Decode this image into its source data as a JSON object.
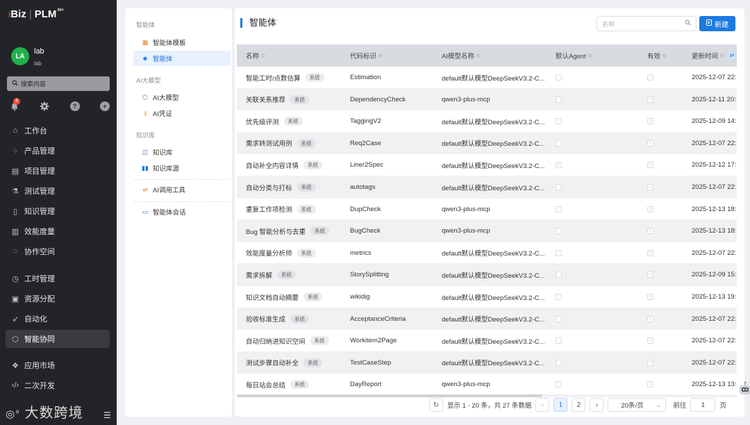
{
  "brand": {
    "name": "Biz",
    "product": "PLM",
    "sup": "AI+",
    "prefix": "i"
  },
  "user": {
    "initials": "LA",
    "name": "lab",
    "sub": "lab"
  },
  "search": {
    "placeholder": "搜索内容"
  },
  "notifications": {
    "count": "4"
  },
  "nav": [
    {
      "label": "工作台",
      "icon": "home-icon"
    },
    {
      "label": "产品管理",
      "icon": "product-icon"
    },
    {
      "label": "项目管理",
      "icon": "project-icon"
    },
    {
      "label": "测试管理",
      "icon": "flask-icon"
    },
    {
      "label": "知识管理",
      "icon": "book-icon"
    },
    {
      "label": "效能度量",
      "icon": "chart-icon"
    },
    {
      "label": "协作空间",
      "icon": "chat-icon"
    },
    {
      "label": "工时管理",
      "icon": "clock-icon"
    },
    {
      "label": "资源分配",
      "icon": "resource-icon"
    },
    {
      "label": "自动化",
      "icon": "rocket-icon"
    },
    {
      "label": "智能协同",
      "icon": "ai-icon"
    },
    {
      "label": "应用市场",
      "icon": "market-icon"
    },
    {
      "label": "二次开发",
      "icon": "code-icon"
    }
  ],
  "watermark": "大数跨境",
  "submenu": {
    "sections": {
      "agent": "智能体",
      "model": "AI大模型",
      "kb": "知识库"
    },
    "items": {
      "agent_template": "智能体模板",
      "agent": "智能体",
      "ai_model": "AI大模型",
      "ai_cred": "AI凭证",
      "kb": "知识库",
      "kb_source": "知识库源",
      "ai_tool": "AI调用工具",
      "agent_chat": "智能体会话"
    }
  },
  "page": {
    "title": "智能体",
    "name_placeholder": "名称",
    "new_button": "新建"
  },
  "table": {
    "columns": [
      "名称",
      "代码标识",
      "AI模型名称",
      "默认Agent",
      "有效",
      "更新时间"
    ],
    "system_tag": "系统",
    "rows": [
      {
        "name": "智能工时/点数估算",
        "code": "Estimation",
        "model": "default默认模型DeepSeekV3.2-C...",
        "default_agent": false,
        "valid": true,
        "updated": "2025-12-07 22:"
      },
      {
        "name": "关联关系推荐",
        "code": "DependencyCheck",
        "model": "qwen3-plus-mcp",
        "default_agent": false,
        "valid": true,
        "updated": "2025-12-11 20:"
      },
      {
        "name": "优先级评测",
        "code": "TaggingV2",
        "model": "default默认模型DeepSeekV3.2-C...",
        "default_agent": false,
        "valid": true,
        "updated": "2025-12-09 14:"
      },
      {
        "name": "需求转测试用例",
        "code": "Req2Case",
        "model": "default默认模型DeepSeekV3.2-C...",
        "default_agent": false,
        "valid": true,
        "updated": "2025-12-07 22:"
      },
      {
        "name": "自动补全内容详情",
        "code": "Liner2Spec",
        "model": "default默认模型DeepSeekV3.2-C...",
        "default_agent": true,
        "valid": true,
        "updated": "2025-12-12 17:"
      },
      {
        "name": "自动分类与打标",
        "code": "autotags",
        "model": "default默认模型DeepSeekV3.2-C...",
        "default_agent": false,
        "valid": true,
        "updated": "2025-12-07 22:"
      },
      {
        "name": "重复工作项检测",
        "code": "DupCheck",
        "model": "qwen3-plus-mcp",
        "default_agent": false,
        "valid": true,
        "updated": "2025-12-13 18:"
      },
      {
        "name": "Bug 智能分析与去重",
        "code": "BugCheck",
        "model": "qwen3-plus-mcp",
        "default_agent": false,
        "valid": true,
        "updated": "2025-12-13 18:"
      },
      {
        "name": "效能度量分析师",
        "code": "metrics",
        "model": "default默认模型DeepSeekV3.2-C...",
        "default_agent": false,
        "valid": true,
        "updated": "2025-12-07 22:"
      },
      {
        "name": "需求拆解",
        "code": "StorySplitting",
        "model": "default默认模型DeepSeekV3.2-C...",
        "default_agent": false,
        "valid": true,
        "updated": "2025-12-09 15:"
      },
      {
        "name": "知识文档自动摘要",
        "code": "wikidig",
        "model": "default默认模型DeepSeekV3.2-C...",
        "default_agent": false,
        "valid": true,
        "updated": "2025-12-13 19:"
      },
      {
        "name": "验收标准生成",
        "code": "AcceptanceCriteria",
        "model": "default默认模型DeepSeekV3.2-C...",
        "default_agent": false,
        "valid": true,
        "updated": "2025-12-07 22:"
      },
      {
        "name": "自动归纳进知识空间",
        "code": "Workitem2Page",
        "model": "default默认模型DeepSeekV3.2-C...",
        "default_agent": false,
        "valid": true,
        "updated": "2025-12-07 22:"
      },
      {
        "name": "测试步骤自动补全",
        "code": "TestCaseStep",
        "model": "default默认模型DeepSeekV3.2-C...",
        "default_agent": false,
        "valid": true,
        "updated": "2025-12-07 22:"
      },
      {
        "name": "每日站会总结",
        "code": "DayReport",
        "model": "qwen3-plus-mcp",
        "default_agent": false,
        "valid": true,
        "updated": "2025-12-13 13:"
      }
    ]
  },
  "pagination": {
    "summary": "显示 1 - 20 条，共 27 条数据",
    "pages": [
      "1",
      "2"
    ],
    "current": "1",
    "page_size": "20条/页",
    "goto_label": "前往",
    "goto_value": "1",
    "page_unit": "页"
  },
  "colors": {
    "accent": "#1f7ae0",
    "sidebar_bg": "#232427",
    "avatar": "#21b14b",
    "badge": "#f04d3a"
  }
}
